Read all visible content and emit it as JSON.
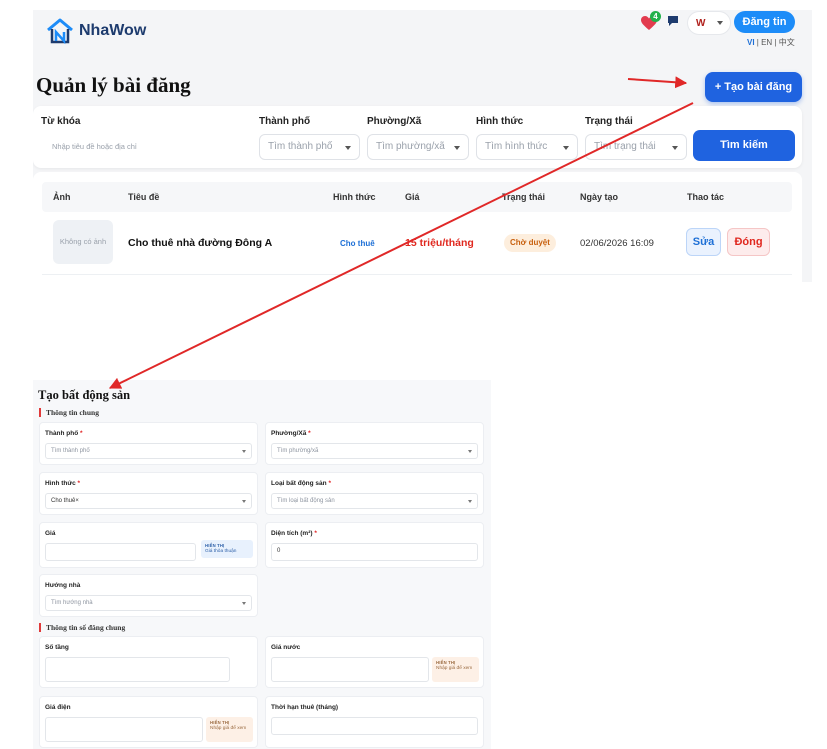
{
  "app": {
    "logo_text": "NhaWow",
    "favorites_count": "4",
    "user_initial": "W",
    "login_label": "Đăng tin",
    "lang": {
      "vi": "VI",
      "en": "EN",
      "zh": "中文"
    }
  },
  "manage": {
    "title": "Quản lý bài đăng",
    "create_label": "+ Tạo bài đăng",
    "filters": {
      "keyword_label": "Từ khóa",
      "keyword_placeholder": "Nhập tiêu đề hoặc địa chỉ",
      "city_label": "Thành phố",
      "city_placeholder": "Tìm thành phố",
      "ward_label": "Phường/Xã",
      "ward_placeholder": "Tìm phường/xã",
      "type_label": "Hình thức",
      "type_placeholder": "Tìm hình thức",
      "status_label": "Trạng thái",
      "status_placeholder": "Tìm trạng thái",
      "search_label": "Tìm kiếm"
    },
    "table": {
      "headers": [
        "Ảnh",
        "Tiêu đề",
        "Hình thức",
        "Giá",
        "Trạng thái",
        "Ngày tạo",
        "Thao tác"
      ],
      "rows": [
        {
          "image": "Không có ảnh",
          "title": "Cho thuê nhà đường Đông A",
          "type": "Cho thuê",
          "price": "15 triệu/tháng",
          "status": "Chờ duyệt",
          "created": "02/06/2026 16:09",
          "edit": "Sửa",
          "close": "Đóng"
        }
      ]
    }
  },
  "form": {
    "title": "Tạo bất động sản",
    "section_general": "Thông tin chung",
    "city_label": "Thành phố",
    "city_placeholder": "Tìm thành phố",
    "ward_label": "Phường/Xã",
    "ward_placeholder": "Tìm phường/xã",
    "type_label": "Hình thức",
    "type_value": "Cho thuê×",
    "property_type_label": "Loại bất động sản",
    "property_type_placeholder": "Tìm loại bất động sản",
    "price_label": "Giá",
    "price_chip_head": "HIỂN THỊ",
    "price_chip_text": "Giá thỏa thuận",
    "area_label": "Diện tích (m²)",
    "area_value": "0",
    "direction_label": "Hướng nhà",
    "direction_placeholder": "Tìm hướng nhà",
    "section_specs": "Thông tin số đăng chung",
    "floors_label": "Số tầng",
    "water_label": "Giá nước",
    "water_chip_head": "HIỂN THỊ",
    "water_chip_text": "Nhập giá để xem",
    "electric_label": "Giá điện",
    "electric_chip_head": "HIỂN THỊ",
    "electric_chip_text": "Nhập giá để xem",
    "lease_label": "Thời hạn thuê (tháng)"
  },
  "colors": {
    "primary": "#1f63e0",
    "accent_red": "#e03a3a",
    "price_red": "#e0281f",
    "pending_orange": "#c8600e",
    "link_blue": "#1d6fd6"
  }
}
